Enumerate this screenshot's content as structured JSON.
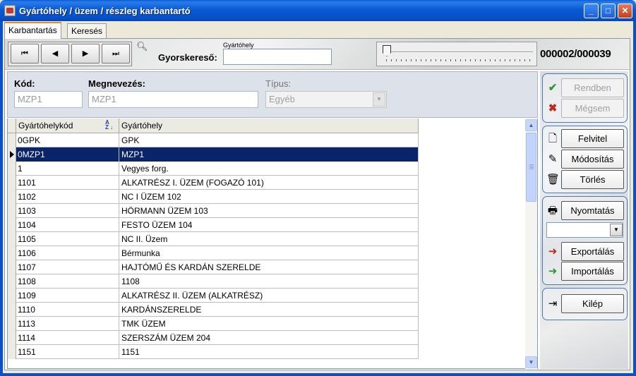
{
  "window": {
    "title": "Gyártóhely / üzem / részleg karbantartó"
  },
  "tabs": [
    {
      "label": "Karbantartás"
    },
    {
      "label": "Keresés"
    }
  ],
  "nav": {
    "first": "⏮",
    "prev": "◀",
    "next": "▶",
    "last": "⏭",
    "quicksearch_caption": "Gyártóhely",
    "quicksearch_label": "Gyorskereső:",
    "quicksearch_value": "",
    "record_counter": "000002/000039"
  },
  "form": {
    "kod_label": "Kód:",
    "kod_value": "MZP1",
    "megnevezes_label": "Megnevezés:",
    "megnevezes_value": "MZP1",
    "tipus_label": "Típus:",
    "tipus_value": "Egyéb"
  },
  "grid": {
    "columns": [
      "Gyártóhelykód",
      "Gyártóhely"
    ],
    "selected_index": 1,
    "rows": [
      [
        "0GPK",
        "GPK"
      ],
      [
        "0MZP1",
        "MZP1"
      ],
      [
        "1",
        "Vegyes forg."
      ],
      [
        "1101",
        "ALKATRÉSZ I. ÜZEM (FOGAZÓ 101)"
      ],
      [
        "1102",
        "NC I ÜZEM 102"
      ],
      [
        "1103",
        "HÖRMANN ÜZEM 103"
      ],
      [
        "1104",
        "FESTO ÜZEM 104"
      ],
      [
        "1105",
        "NC II. Üzem"
      ],
      [
        "1106",
        "Bérmunka"
      ],
      [
        "1107",
        "HAJTÓMŰ ÉS KARDÁN SZERELDE"
      ],
      [
        "1108",
        "1108"
      ],
      [
        "1109",
        "ALKATRÉSZ II. ÜZEM (ALKATRÉSZ)"
      ],
      [
        "1110",
        "KARDÁNSZERELDE"
      ],
      [
        "1113",
        "TMK ÜZEM"
      ],
      [
        "1114",
        "SZERSZÁM ÜZEM 204"
      ],
      [
        "1151",
        "1151"
      ]
    ]
  },
  "actions": {
    "rendben": "Rendben",
    "megsem": "Mégsem",
    "felvitel": "Felvitel",
    "modositas": "Módosítás",
    "torles": "Törlés",
    "nyomtatas": "Nyomtatás",
    "print_option": "",
    "exportalas": "Exportálás",
    "importalas": "Importálás",
    "kilep": "Kilép"
  },
  "colors": {
    "titlebar": "#0a5ad1",
    "selection": "#0a246a",
    "group_border": "#4a78c2"
  }
}
